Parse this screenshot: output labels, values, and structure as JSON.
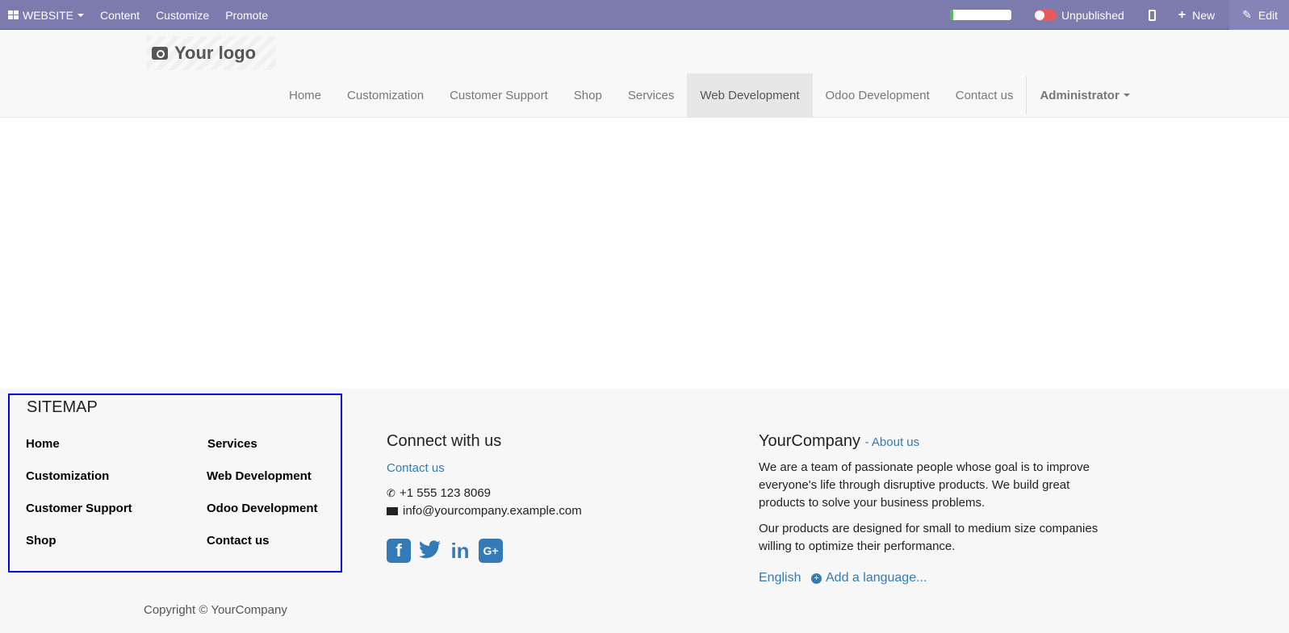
{
  "adminbar": {
    "website_label": "WEBSITE",
    "menu": [
      "Content",
      "Customize",
      "Promote"
    ],
    "progress_fraction": 0.05,
    "status_label": "Unpublished",
    "new_label": "New",
    "edit_label": "Edit"
  },
  "header": {
    "logo_text": "Your logo",
    "nav": [
      "Home",
      "Customization",
      "Customer Support",
      "Shop",
      "Services",
      "Web Development",
      "Odoo Development",
      "Contact us"
    ],
    "active_nav": "Web Development",
    "user": "Administrator"
  },
  "footer": {
    "sitemap": {
      "title": "SITEMAP",
      "col1": [
        "Home",
        "Customization",
        "Customer Support",
        "Shop"
      ],
      "col2": [
        "Services",
        "Web Development",
        "Odoo Development",
        "Contact us"
      ]
    },
    "connect": {
      "title": "Connect with us",
      "contact_link": "Contact us",
      "phone": "+1 555 123 8069",
      "email": "info@yourcompany.example.com",
      "socials": [
        "facebook-icon",
        "twitter-icon",
        "linkedin-icon",
        "google-plus-icon"
      ]
    },
    "company": {
      "name": "YourCompany",
      "about_link": "- About us",
      "p1": "We are a team of passionate people whose goal is to improve everyone's life through disruptive products. We build great products to solve your business problems.",
      "p2": "Our products are designed for small to medium size companies willing to optimize their performance.",
      "language": "English",
      "add_language": "Add a language..."
    },
    "copyright": "Copyright © YourCompany"
  },
  "colors": {
    "adminbar": "#7c7bad",
    "link": "#337ab7",
    "sitemap_border": "#0000e6"
  }
}
